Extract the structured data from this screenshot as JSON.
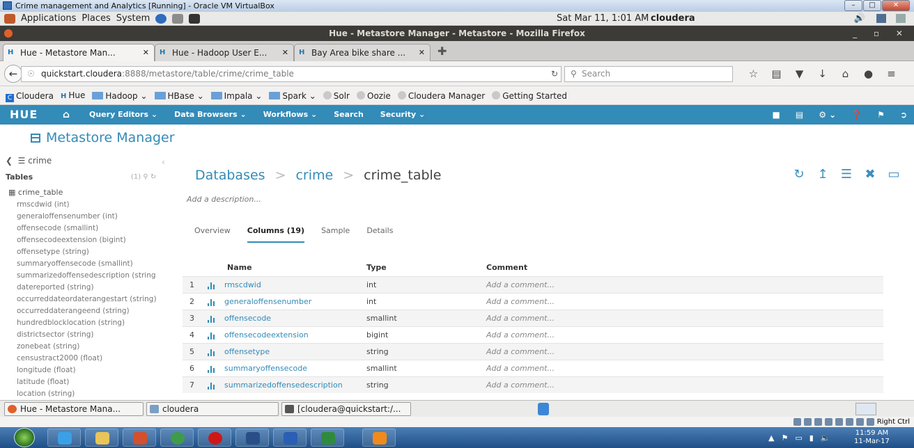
{
  "vbox": {
    "title": "Crime management and Analytics  [Running] - Oracle VM VirtualBox",
    "status_label": "Right Ctrl"
  },
  "gnome_panel": {
    "menus": [
      "Applications",
      "Places",
      "System"
    ],
    "clock": "Sat Mar 11,  1:01 AM",
    "user": "cloudera"
  },
  "firefox": {
    "window_title": "Hue - Metastore Manager - Metastore - Mozilla Firefox",
    "tabs": [
      {
        "label": "Hue - Metastore Man...",
        "active": true
      },
      {
        "label": "Hue - Hadoop User E...",
        "active": false
      },
      {
        "label": "Bay Area bike share ...",
        "active": false
      }
    ],
    "url_host": "quickstart.cloudera",
    "url_rest": ":8888/metastore/table/crime/crime_table",
    "search_placeholder": "Search",
    "bookmarks": [
      "Cloudera",
      "Hue",
      "Hadoop",
      "HBase",
      "Impala",
      "Spark",
      "Solr",
      "Oozie",
      "Cloudera Manager",
      "Getting Started"
    ]
  },
  "hue_nav": {
    "logo": "HUE",
    "menu": [
      "Query Editors",
      "Data Browsers",
      "Workflows",
      "Search",
      "Security"
    ]
  },
  "page_title": "Metastore Manager",
  "sidebar": {
    "database": "crime",
    "tables_label": "Tables",
    "tables_count": "(1)",
    "table_name": "crime_table",
    "columns": [
      "rmscdwid (int)",
      "generaloffensenumber (int)",
      "offensecode (smallint)",
      "offensecodeextension (bigint)",
      "offensetype (string)",
      "summaryoffensecode (smallint)",
      "summarizedoffensedescription (string",
      "datereported (string)",
      "occurreddateordaterangestart (string)",
      "occurreddaterangeend (string)",
      "hundredblocklocation (string)",
      "districtsector (string)",
      "zonebeat (string)",
      "censustract2000 (float)",
      "longitude (float)",
      "latitude (float)",
      "location (string)"
    ]
  },
  "breadcrumb": {
    "databases": "Databases",
    "db": "crime",
    "table": "crime_table"
  },
  "description_placeholder": "Add a description...",
  "subtabs": [
    "Overview",
    "Columns (19)",
    "Sample",
    "Details"
  ],
  "table": {
    "headers": {
      "name": "Name",
      "type": "Type",
      "comment": "Comment"
    },
    "rows": [
      {
        "num": "1",
        "name": "rmscdwid",
        "type": "int",
        "comment": "Add a comment..."
      },
      {
        "num": "2",
        "name": "generaloffensenumber",
        "type": "int",
        "comment": "Add a comment..."
      },
      {
        "num": "3",
        "name": "offensecode",
        "type": "smallint",
        "comment": "Add a comment..."
      },
      {
        "num": "4",
        "name": "offensecodeextension",
        "type": "bigint",
        "comment": "Add a comment..."
      },
      {
        "num": "5",
        "name": "offensetype",
        "type": "string",
        "comment": "Add a comment..."
      },
      {
        "num": "6",
        "name": "summaryoffensecode",
        "type": "smallint",
        "comment": "Add a comment..."
      },
      {
        "num": "7",
        "name": "summarizedoffensedescription",
        "type": "string",
        "comment": "Add a comment..."
      }
    ]
  },
  "gnome_taskbar": {
    "items": [
      "Hue - Metastore Mana...",
      "cloudera",
      "[cloudera@quickstart:/..."
    ]
  },
  "win_clock": {
    "time": "11:59 AM",
    "date": "11-Mar-17"
  },
  "colors": {
    "hue_blue": "#338bb8",
    "firefox_title": "#3c3b37"
  }
}
